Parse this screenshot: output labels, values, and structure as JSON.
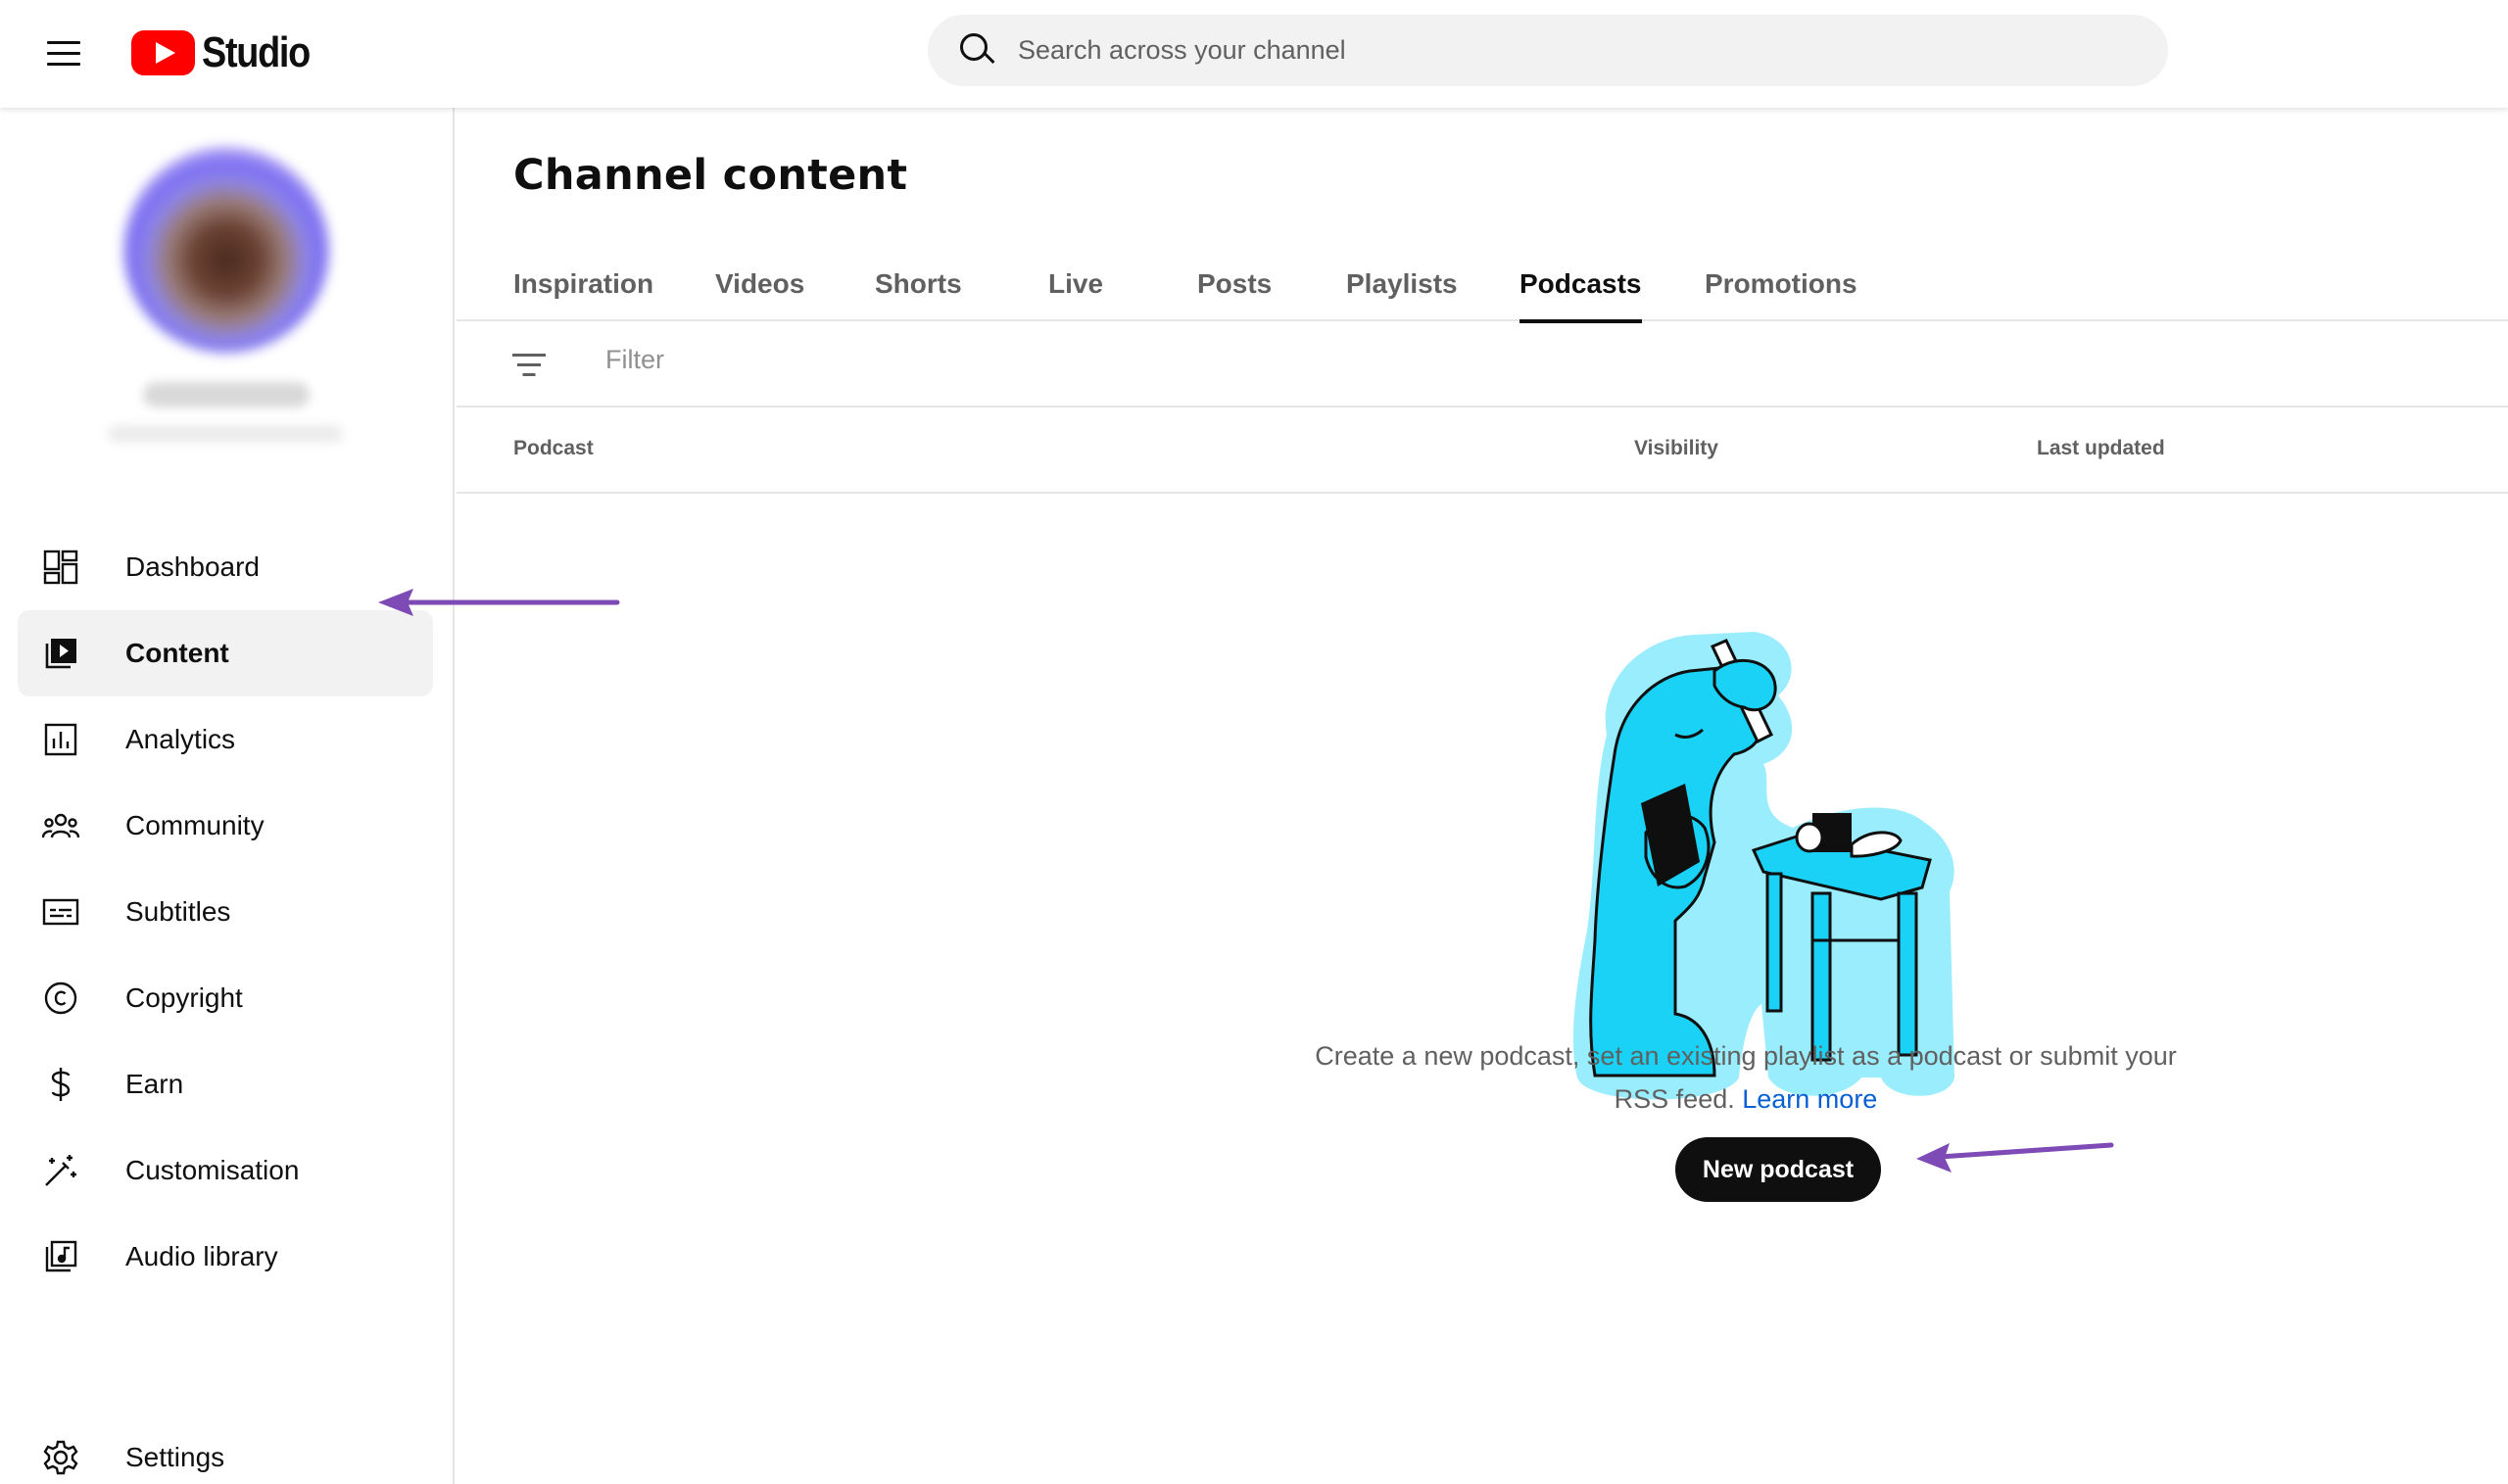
{
  "header": {
    "app_name": "Studio",
    "search_placeholder": "Search across your channel"
  },
  "sidebar": {
    "items": [
      {
        "label": "Dashboard",
        "icon": "dashboard-icon",
        "active": false
      },
      {
        "label": "Content",
        "icon": "content-icon",
        "active": true
      },
      {
        "label": "Analytics",
        "icon": "analytics-icon",
        "active": false
      },
      {
        "label": "Community",
        "icon": "community-icon",
        "active": false
      },
      {
        "label": "Subtitles",
        "icon": "subtitles-icon",
        "active": false
      },
      {
        "label": "Copyright",
        "icon": "copyright-icon",
        "active": false
      },
      {
        "label": "Earn",
        "icon": "earn-icon",
        "active": false
      },
      {
        "label": "Customisation",
        "icon": "customisation-icon",
        "active": false
      },
      {
        "label": "Audio library",
        "icon": "audio-library-icon",
        "active": false
      }
    ],
    "settings_label": "Settings"
  },
  "main": {
    "title": "Channel content",
    "tabs": [
      {
        "label": "Inspiration",
        "active": false
      },
      {
        "label": "Videos",
        "active": false
      },
      {
        "label": "Shorts",
        "active": false
      },
      {
        "label": "Live",
        "active": false
      },
      {
        "label": "Posts",
        "active": false
      },
      {
        "label": "Playlists",
        "active": false
      },
      {
        "label": "Podcasts",
        "active": true
      },
      {
        "label": "Promotions",
        "active": false
      }
    ],
    "filter_placeholder": "Filter",
    "columns": {
      "podcast": "Podcast",
      "visibility": "Visibility",
      "last_updated": "Last updated"
    },
    "empty_state": {
      "text": "Create a new podcast, set an existing playlist as a podcast or submit your RSS feed.",
      "link": "Learn more",
      "button": "New podcast"
    }
  },
  "colors": {
    "brand_red": "#ff0000",
    "link_blue": "#065fd4",
    "annotation_arrow": "#7d4ab6",
    "illustration_cyan": "#19d2f5"
  }
}
